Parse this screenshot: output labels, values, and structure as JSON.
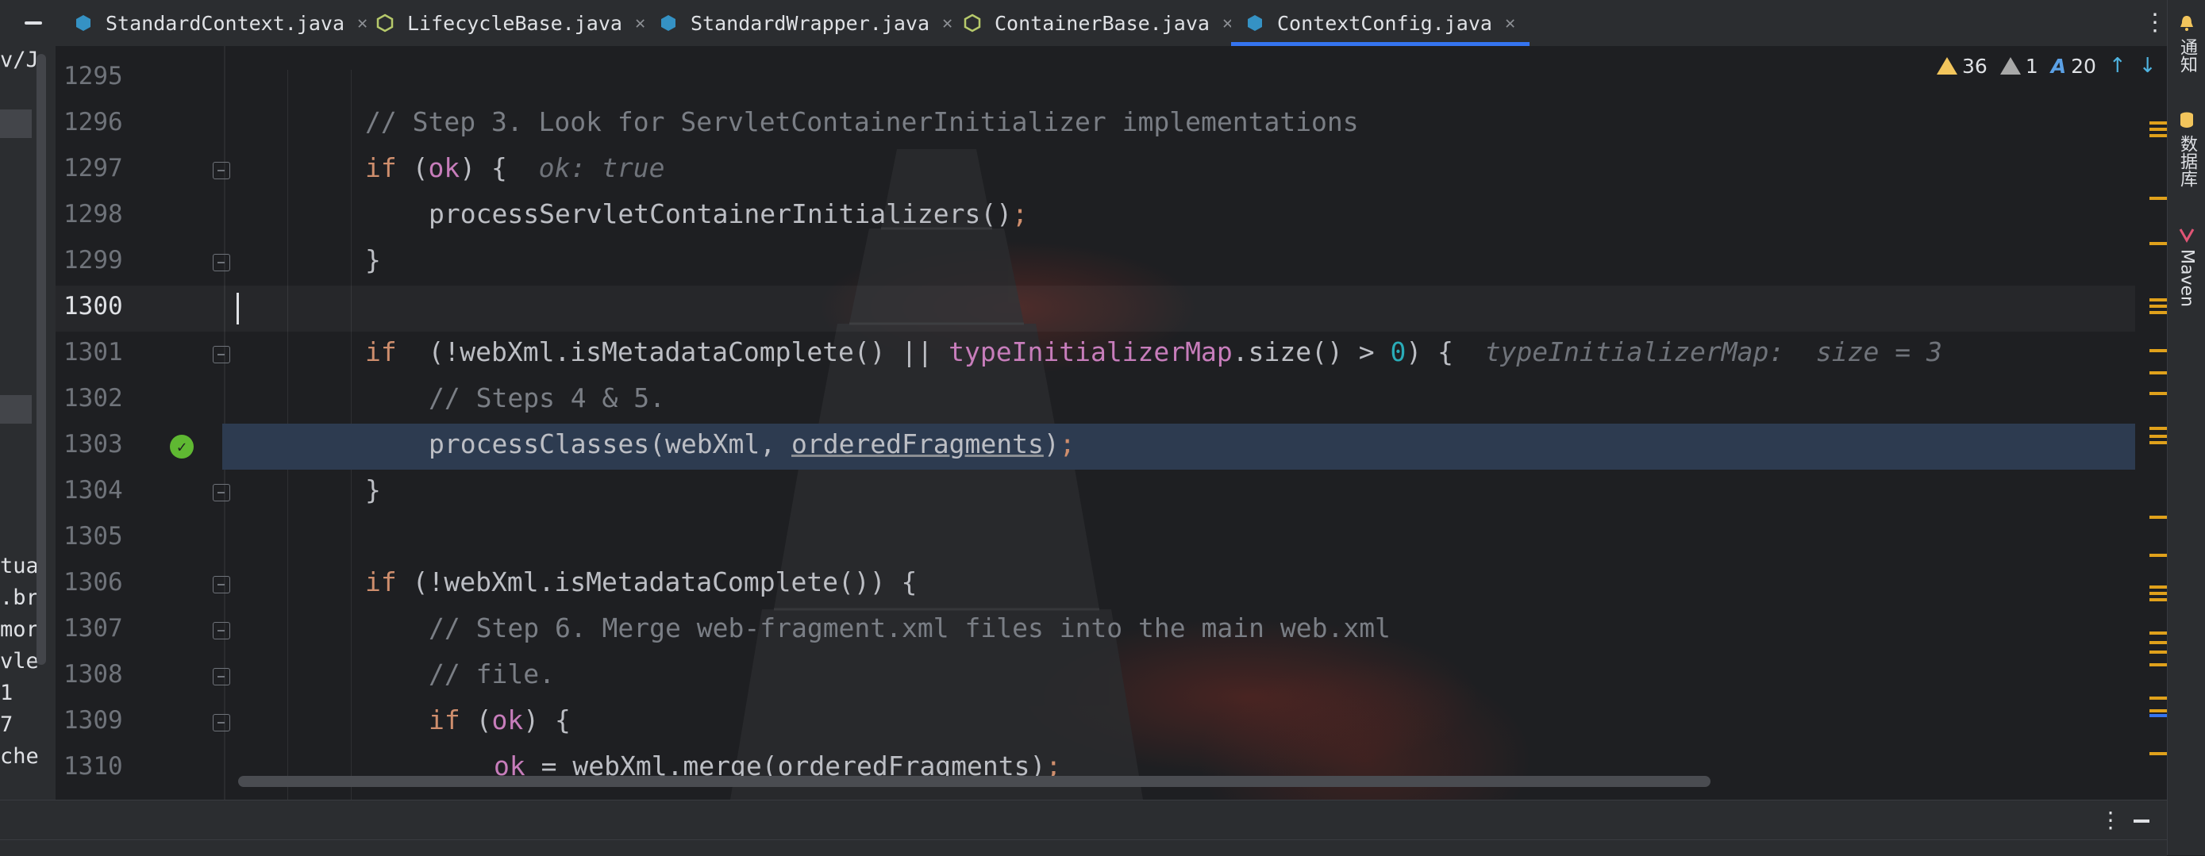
{
  "tabs": [
    {
      "label": "StandardContext.java",
      "icon": "java-class-icon",
      "color": "#3592c4",
      "active": false
    },
    {
      "label": "LifecycleBase.java",
      "icon": "java-abstract-icon",
      "color": "#9aa95b",
      "active": false
    },
    {
      "label": "StandardWrapper.java",
      "icon": "java-class-icon",
      "color": "#3592c4",
      "active": false
    },
    {
      "label": "ContainerBase.java",
      "icon": "java-abstract-icon",
      "color": "#9aa95b",
      "active": false
    },
    {
      "label": "ContextConfig.java",
      "icon": "java-class-icon",
      "color": "#3592c4",
      "active": true
    }
  ],
  "right_sidebar": {
    "notifications": "通知",
    "database": "数据库",
    "maven": "Maven"
  },
  "project_strip": {
    "fragments": [
      "v/J",
      "tua",
      ".br",
      "mor",
      "vle",
      "1",
      "7",
      "che"
    ]
  },
  "inspections": {
    "warnings": "36",
    "weak_warnings": "1",
    "typos": "20"
  },
  "editor": {
    "lines": [
      {
        "num": "1295"
      },
      {
        "num": "1296"
      },
      {
        "num": "1297"
      },
      {
        "num": "1298"
      },
      {
        "num": "1299"
      },
      {
        "num": "1300"
      },
      {
        "num": "1301"
      },
      {
        "num": "1302"
      },
      {
        "num": "1303"
      },
      {
        "num": "1304"
      },
      {
        "num": "1305"
      },
      {
        "num": "1306"
      },
      {
        "num": "1307"
      },
      {
        "num": "1308"
      },
      {
        "num": "1309"
      },
      {
        "num": "1310"
      }
    ],
    "tokens": {
      "c1296": "// Step 3. Look for ServletContainerInitializer implementations",
      "if": "if",
      "ok": "ok",
      "hint_ok": "ok: true",
      "processSCI": "processServletContainerInitializers()",
      "semi": ";",
      "close_brace": "}",
      "not_meta": "(!webXml.isMetadataComplete() || ",
      "typeInitializerMap": "typeInitializerMap",
      "size_gt": ".size() > ",
      "zero": "0",
      "open_paren_brace": ") {",
      "hint_tim": "typeInitializerMap:  size = 3",
      "c1302": "// Steps 4 & 5.",
      "processClasses": "processClasses(webXml, ",
      "orderedFragments": "orderedFragments",
      "close_paren": ")",
      "meta_cond": "(!webXml.isMetadataComplete()) {",
      "c1307": "// Step 6. Merge web-fragment.xml files into the main web.xml",
      "c1308": "// file.",
      "paren_open": "(",
      "brace_open": ") {",
      "merge_rhs": " = webXml.merge(orderedFragments)",
      "open_brace": " {",
      "paren_ok_open": " ("
    }
  },
  "colors": {
    "keyword": "#cf8e6d",
    "comment": "#7a7e85",
    "field": "#c77dbb",
    "number": "#2aacb8",
    "execution_line": "#2d3b50",
    "breakpoint": "#5fb832",
    "accent": "#3574f0"
  }
}
